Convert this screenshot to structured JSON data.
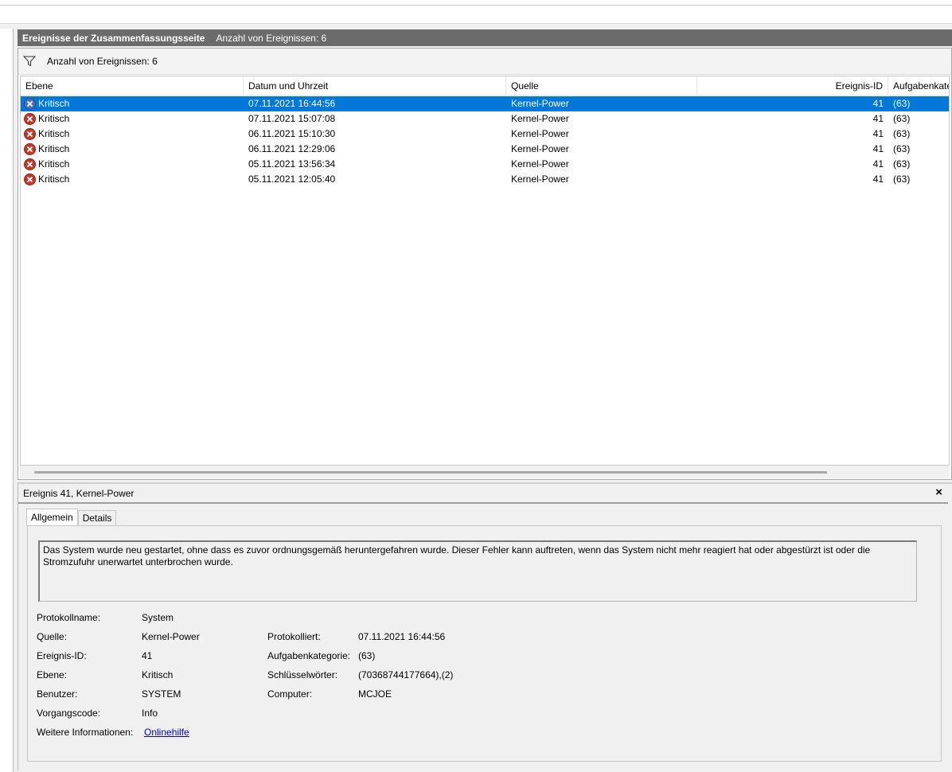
{
  "header": {
    "title": "Ereignisse der Zusammenfassungsseite",
    "count": "Anzahl von Ereignissen: 6"
  },
  "filterbar": {
    "text": "Anzahl von Ereignissen: 6",
    "icon": "funnel-icon"
  },
  "table": {
    "columns": [
      "Ebene",
      "Datum und Uhrzeit",
      "Quelle",
      "Ereignis-ID",
      "Aufgabenkategorie"
    ],
    "rows": [
      {
        "level": "Kritisch",
        "datetime": "07.11.2021 16:44:56",
        "source": "Kernel-Power",
        "id": "41",
        "category": "(63)"
      },
      {
        "level": "Kritisch",
        "datetime": "07.11.2021 15:07:08",
        "source": "Kernel-Power",
        "id": "41",
        "category": "(63)"
      },
      {
        "level": "Kritisch",
        "datetime": "06.11.2021 15:10:30",
        "source": "Kernel-Power",
        "id": "41",
        "category": "(63)"
      },
      {
        "level": "Kritisch",
        "datetime": "06.11.2021 12:29:06",
        "source": "Kernel-Power",
        "id": "41",
        "category": "(63)"
      },
      {
        "level": "Kritisch",
        "datetime": "05.11.2021 13:56:34",
        "source": "Kernel-Power",
        "id": "41",
        "category": "(63)"
      },
      {
        "level": "Kritisch",
        "datetime": "05.11.2021 12:05:40",
        "source": "Kernel-Power",
        "id": "41",
        "category": "(63)"
      }
    ]
  },
  "detail": {
    "title": "Ereignis 41, Kernel-Power",
    "close": "×",
    "tabs": [
      "Allgemein",
      "Details"
    ],
    "description": "Das System wurde neu gestartet, ohne dass es zuvor ordnungsgemäß heruntergefahren wurde. Dieser Fehler kann auftreten, wenn das System nicht mehr reagiert hat oder abgestürzt ist oder die Stromzufuhr unerwartet unterbrochen wurde.",
    "props": {
      "protokollname_label": "Protokollname:",
      "protokollname_value": "System",
      "quelle_label": "Quelle:",
      "quelle_value": "Kernel-Power",
      "protokolliert_label": "Protokolliert:",
      "protokolliert_value": "07.11.2021 16:44:56",
      "ereignisid_label": "Ereignis-ID:",
      "ereignisid_value": "41",
      "aufgabenkategorie_label": "Aufgabenkategorie:",
      "aufgabenkategorie_value": "(63)",
      "ebene_label": "Ebene:",
      "ebene_value": "Kritisch",
      "schluesselwoerter_label": "Schlüsselwörter:",
      "schluesselwoerter_value": "(70368744177664),(2)",
      "benutzer_label": "Benutzer:",
      "benutzer_value": "SYSTEM",
      "computer_label": "Computer:",
      "computer_value": "MCJOE",
      "vorgangscode_label": "Vorgangscode:",
      "vorgangscode_value": "Info",
      "weitere_label": "Weitere Informationen:",
      "weitere_value": "Onlinehilfe"
    }
  },
  "colors": {
    "header_bg": "#6b6b6b",
    "selection": "#0078d7",
    "critical_icon": "#c0392b",
    "link": "#0000cc"
  }
}
